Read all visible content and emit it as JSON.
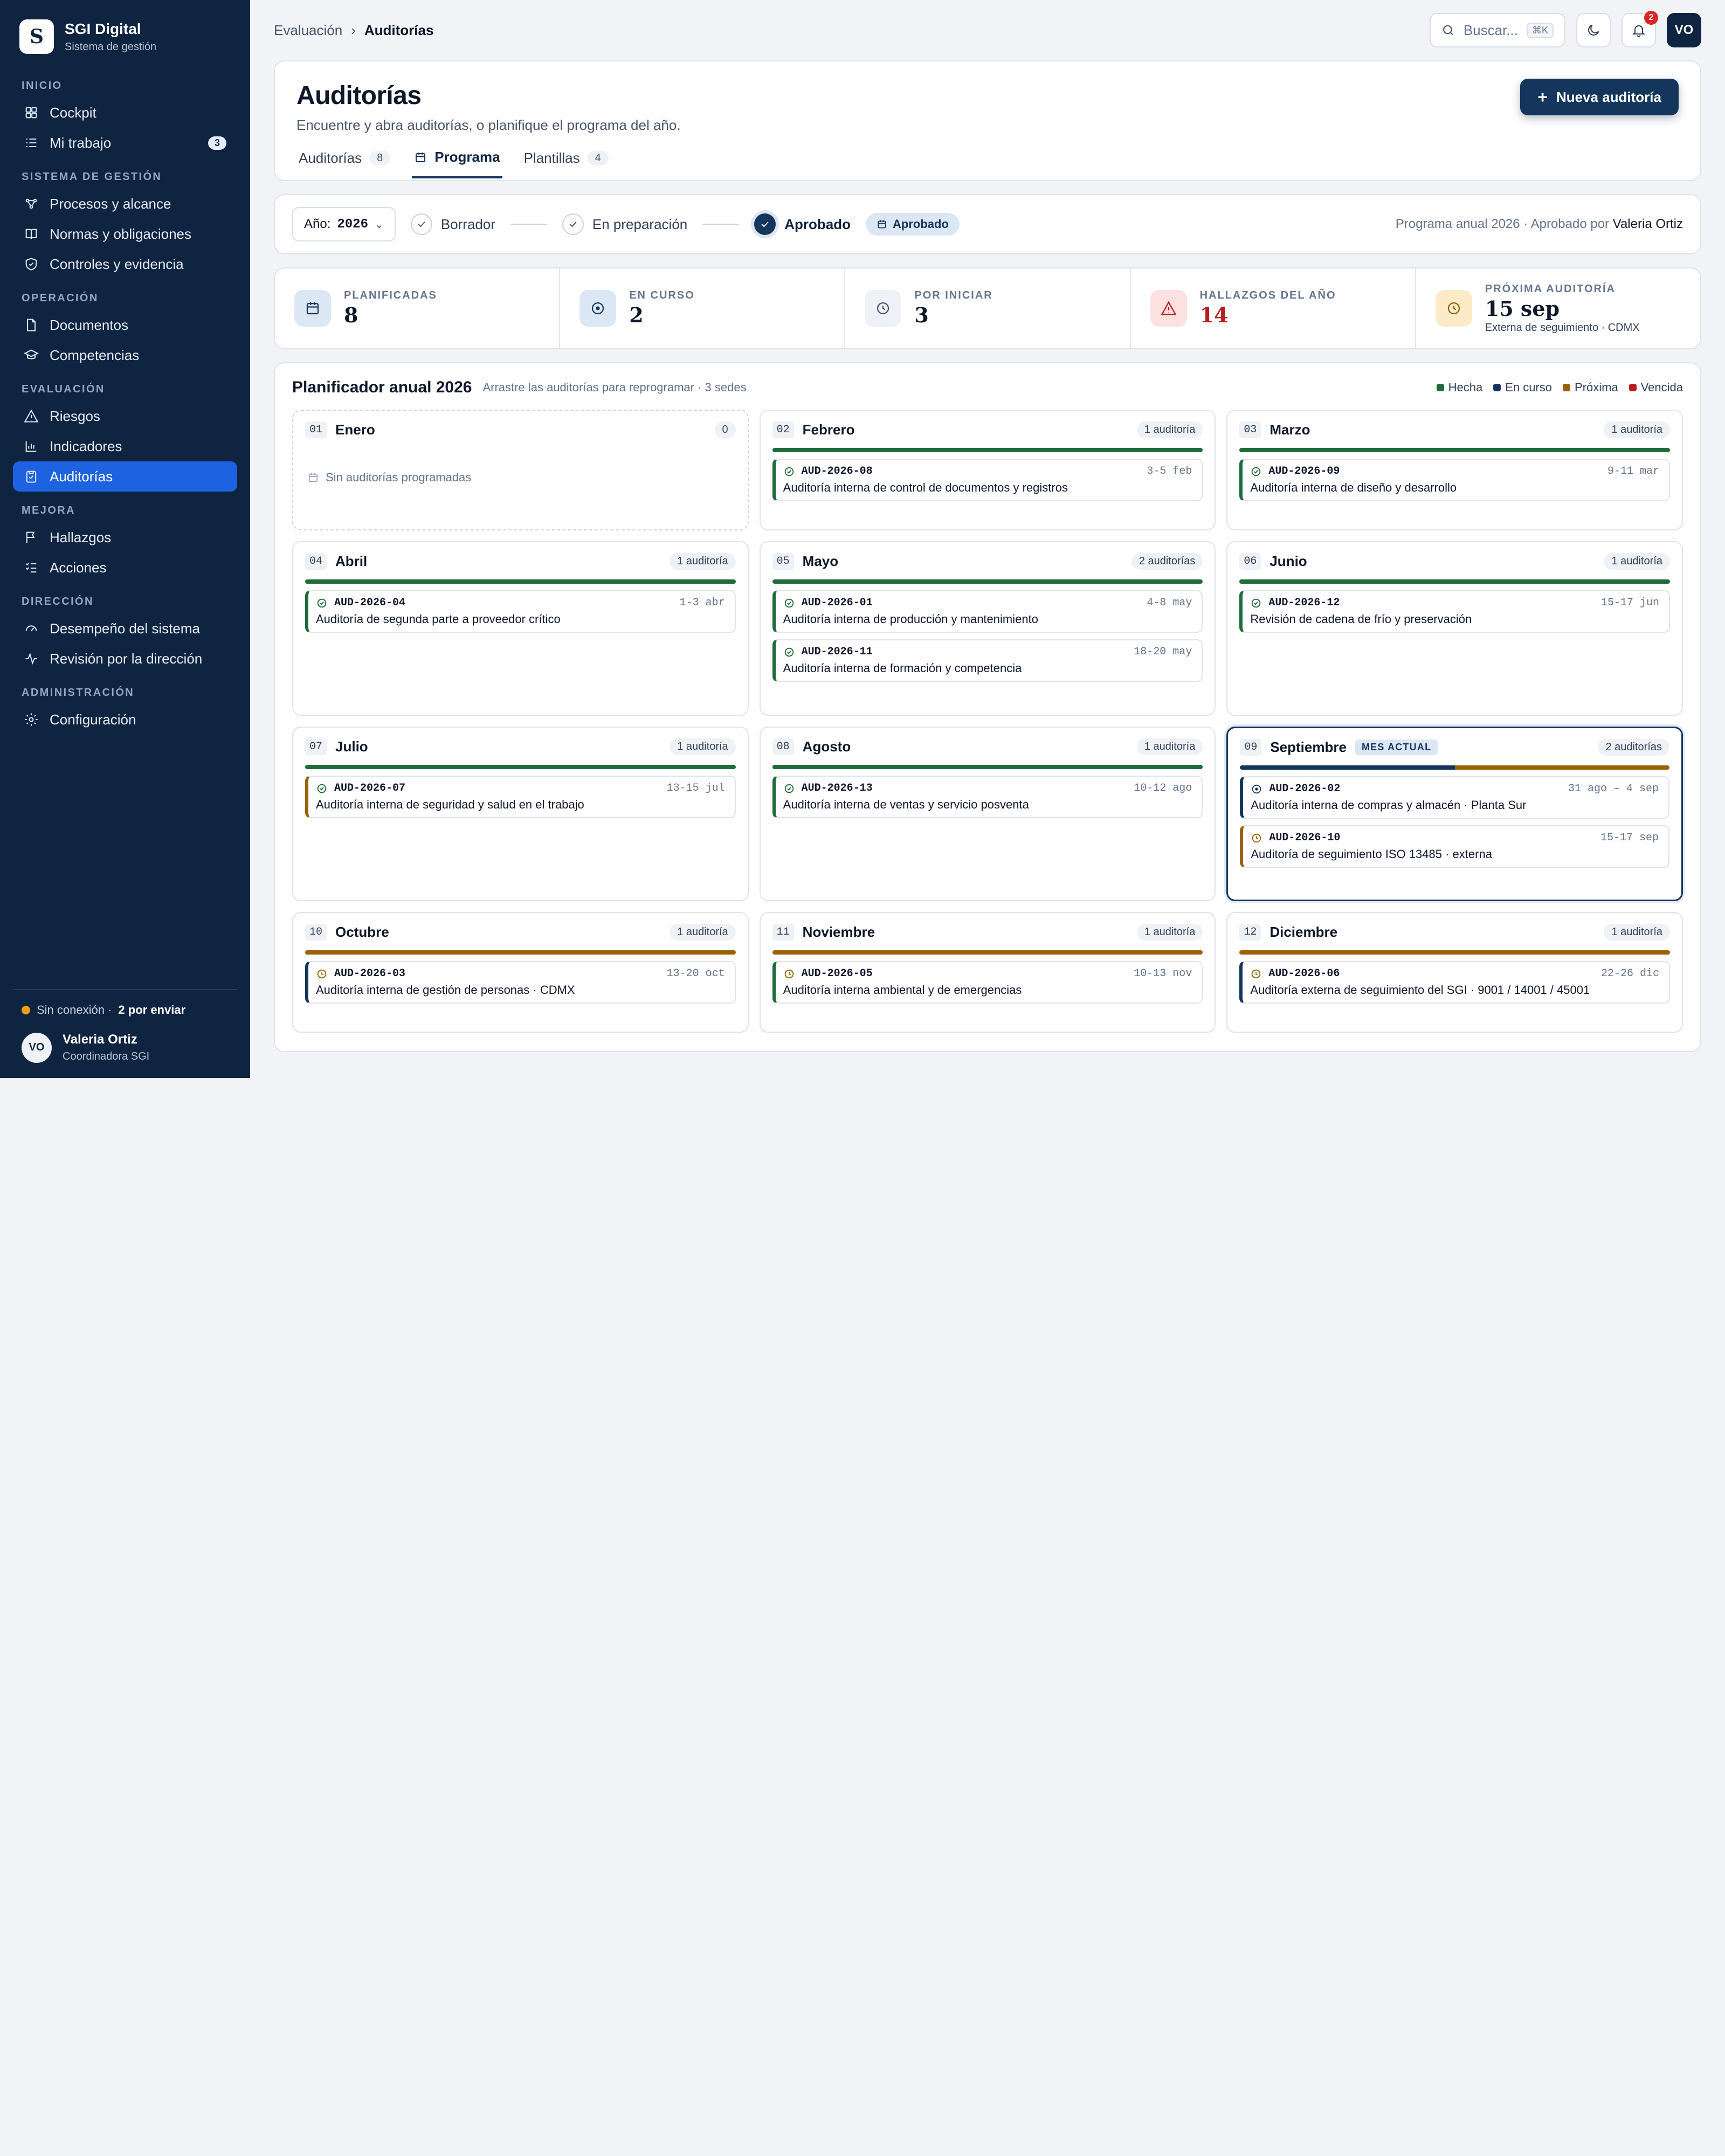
{
  "app": {
    "name": "SGI Digital",
    "subtitle": "Sistema de gestión",
    "logo_letter": "S"
  },
  "sidebar": {
    "sections": [
      {
        "title": "INICIO",
        "items": [
          {
            "label": "Cockpit",
            "icon": "dashboard-icon"
          },
          {
            "label": "Mi trabajo",
            "icon": "tasks-icon",
            "badge": "3"
          }
        ]
      },
      {
        "title": "SISTEMA DE GESTIÓN",
        "items": [
          {
            "label": "Procesos y alcance",
            "icon": "process-icon"
          },
          {
            "label": "Normas y obligaciones",
            "icon": "book-icon"
          },
          {
            "label": "Controles y evidencia",
            "icon": "shield-icon"
          }
        ]
      },
      {
        "title": "OPERACIÓN",
        "items": [
          {
            "label": "Documentos",
            "icon": "document-icon"
          },
          {
            "label": "Competencias",
            "icon": "graduation-cap-icon"
          }
        ]
      },
      {
        "title": "EVALUACIÓN",
        "items": [
          {
            "label": "Riesgos",
            "icon": "warning-icon"
          },
          {
            "label": "Indicadores",
            "icon": "bar-chart-icon"
          },
          {
            "label": "Auditorías",
            "icon": "clipboard-check-icon",
            "active": true
          }
        ]
      },
      {
        "title": "MEJORA",
        "items": [
          {
            "label": "Hallazgos",
            "icon": "flag-icon"
          },
          {
            "label": "Acciones",
            "icon": "checklist-icon"
          }
        ]
      },
      {
        "title": "DIRECCIÓN",
        "items": [
          {
            "label": "Desempeño del sistema",
            "icon": "gauge-icon"
          },
          {
            "label": "Revisión por la dirección",
            "icon": "activity-icon"
          }
        ]
      },
      {
        "title": "ADMINISTRACIÓN",
        "items": [
          {
            "label": "Configuración",
            "icon": "gear-icon"
          }
        ]
      }
    ],
    "connection": {
      "status": "Sin conexión ·",
      "pending": "2 por enviar"
    },
    "user": {
      "initials": "VO",
      "name": "Valeria Ortiz",
      "role": "Coordinadora SGI"
    }
  },
  "topbar": {
    "breadcrumb": [
      "Evaluación",
      "Auditorías"
    ],
    "search_placeholder": "Buscar...",
    "search_shortcut": "⌘K",
    "notifications": "2",
    "avatar": "VO"
  },
  "header": {
    "title": "Auditorías",
    "subtitle": "Encuentre y abra auditorías, o planifique el programa del año.",
    "new_button": "Nueva auditoría",
    "tabs": [
      {
        "label": "Auditorías",
        "count": "8"
      },
      {
        "label": "Programa",
        "active": true
      },
      {
        "label": "Plantillas",
        "count": "4"
      }
    ]
  },
  "status": {
    "year_label": "Año:",
    "year": "2026",
    "steps": [
      {
        "label": "Borrador",
        "done": false
      },
      {
        "label": "En preparación",
        "done": false
      },
      {
        "label": "Aprobado",
        "done": true
      }
    ],
    "pill": "Aprobado",
    "info": "Programa anual 2026 · Aprobado por",
    "approver": "Valeria Ortiz"
  },
  "kpis": [
    {
      "label": "PLANIFICADAS",
      "value": "8",
      "icon": "calendar-icon",
      "bg": "#dce7f5",
      "stroke": "#15365c",
      "color": "#0f172a"
    },
    {
      "label": "EN CURSO",
      "value": "2",
      "icon": "in-progress-icon",
      "bg": "#dce7f5",
      "stroke": "#15365c",
      "color": "#0f172a"
    },
    {
      "label": "POR INICIAR",
      "value": "3",
      "icon": "clock-icon",
      "bg": "#eef1f5",
      "stroke": "#475569",
      "color": "#0f172a"
    },
    {
      "label": "HALLAZGOS DEL AÑO",
      "value": "14",
      "icon": "warning-icon",
      "bg": "#fde0e0",
      "stroke": "#b91c1c",
      "color": "#b91c1c"
    },
    {
      "label": "PRÓXIMA AUDITORÍA",
      "value": "15 sep",
      "sub": "Externa de seguimiento · CDMX",
      "icon": "clock-icon",
      "bg": "#fdebc8",
      "stroke": "#92600a",
      "color": "#0f172a"
    }
  ],
  "planner": {
    "title": "Planificador anual 2026",
    "subtitle": "Arrastre las auditorías para reprogramar · 3 sedes",
    "legend": [
      {
        "label": "Hecha",
        "color": "#1f6b3a"
      },
      {
        "label": "En curso",
        "color": "#15365c"
      },
      {
        "label": "Próxima",
        "color": "#9a6207"
      },
      {
        "label": "Vencida",
        "color": "#b91c1c"
      }
    ],
    "empty_text": "Sin auditorías programadas",
    "current_tag": "MES ACTUAL",
    "months": [
      {
        "num": "01",
        "name": "Enero",
        "count": "0",
        "bar": [],
        "audits": []
      },
      {
        "num": "02",
        "name": "Febrero",
        "count": "1 auditoría",
        "bar": [
          "done"
        ],
        "audits": [
          {
            "code": "AUD-2026-08",
            "dates": "3-5 feb",
            "title": "Auditoría interna de control de documentos y registros",
            "status": "done"
          }
        ]
      },
      {
        "num": "03",
        "name": "Marzo",
        "count": "1 auditoría",
        "bar": [
          "done"
        ],
        "audits": [
          {
            "code": "AUD-2026-09",
            "dates": "9-11 mar",
            "title": "Auditoría interna de diseño y desarrollo",
            "status": "done"
          }
        ]
      },
      {
        "num": "04",
        "name": "Abril",
        "count": "1 auditoría",
        "bar": [
          "done"
        ],
        "audits": [
          {
            "code": "AUD-2026-04",
            "dates": "1-3 abr",
            "title": "Auditoría de segunda parte a proveedor crítico",
            "status": "done"
          }
        ]
      },
      {
        "num": "05",
        "name": "Mayo",
        "count": "2 auditorías",
        "bar": [
          "done"
        ],
        "audits": [
          {
            "code": "AUD-2026-01",
            "dates": "4-8 may",
            "title": "Auditoría interna de producción y mantenimiento",
            "status": "done"
          },
          {
            "code": "AUD-2026-11",
            "dates": "18-20 may",
            "title": "Auditoría interna de formación y competencia",
            "status": "done"
          }
        ]
      },
      {
        "num": "06",
        "name": "Junio",
        "count": "1 auditoría",
        "bar": [
          "done"
        ],
        "audits": [
          {
            "code": "AUD-2026-12",
            "dates": "15-17 jun",
            "title": "Revisión de cadena de frío y preservación",
            "status": "done"
          }
        ]
      },
      {
        "num": "07",
        "name": "Julio",
        "count": "1 auditoría",
        "bar": [
          "done"
        ],
        "audits": [
          {
            "code": "AUD-2026-07",
            "dates": "13-15 jul",
            "title": "Auditoría interna de seguridad y salud en el trabajo",
            "status": "done",
            "border": "next"
          }
        ]
      },
      {
        "num": "08",
        "name": "Agosto",
        "count": "1 auditoría",
        "bar": [
          "done"
        ],
        "audits": [
          {
            "code": "AUD-2026-13",
            "dates": "10-12 ago",
            "title": "Auditoría interna de ventas y servicio posventa",
            "status": "done"
          }
        ]
      },
      {
        "num": "09",
        "name": "Septiembre",
        "count": "2 auditorías",
        "current": true,
        "bar": [
          "progress",
          "next"
        ],
        "audits": [
          {
            "code": "AUD-2026-02",
            "dates": "31 ago – 4 sep",
            "title": "Auditoría interna de compras y almacén · Planta Sur",
            "status": "progress"
          },
          {
            "code": "AUD-2026-10",
            "dates": "15-17 sep",
            "title": "Auditoría de seguimiento ISO 13485 · externa",
            "status": "next"
          }
        ]
      },
      {
        "num": "10",
        "name": "Octubre",
        "count": "1 auditoría",
        "bar": [
          "next"
        ],
        "audits": [
          {
            "code": "AUD-2026-03",
            "dates": "13-20 oct",
            "title": "Auditoría interna de gestión de personas · CDMX",
            "status": "next",
            "border": "progress"
          }
        ]
      },
      {
        "num": "11",
        "name": "Noviembre",
        "count": "1 auditoría",
        "bar": [
          "next"
        ],
        "audits": [
          {
            "code": "AUD-2026-05",
            "dates": "10-13 nov",
            "title": "Auditoría interna ambiental y de emergencias",
            "status": "next",
            "border": "done"
          }
        ]
      },
      {
        "num": "12",
        "name": "Diciembre",
        "count": "1 auditoría",
        "bar": [
          "next"
        ],
        "audits": [
          {
            "code": "AUD-2026-06",
            "dates": "22-26 dic",
            "title": "Auditoría externa de seguimiento del SGI · 9001 / 14001 / 45001",
            "status": "next",
            "border": "progress"
          }
        ]
      }
    ]
  },
  "colors": {
    "done": "#1f6b3a",
    "progress": "#15365c",
    "next": "#9a6207",
    "overdue": "#b91c1c",
    "sidebar": "#0f2440",
    "active_nav": "#1d62e0"
  }
}
